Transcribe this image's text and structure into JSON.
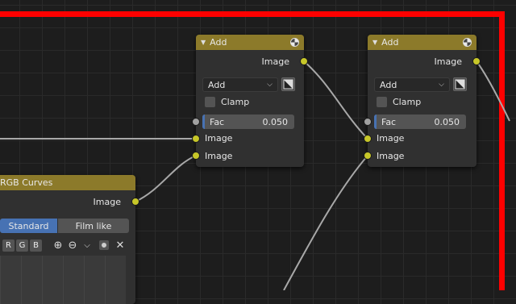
{
  "nodes": {
    "add_1": {
      "title": "Add",
      "output_label": "Image",
      "blend_mode": "Add",
      "clamp_label": "Clamp",
      "clamp_checked": false,
      "fac_label": "Fac",
      "fac_value": "0.050",
      "inputs": [
        "Image",
        "Image"
      ]
    },
    "add_2": {
      "title": "Add",
      "output_label": "Image",
      "blend_mode": "Add",
      "clamp_label": "Clamp",
      "clamp_checked": false,
      "fac_label": "Fac",
      "fac_value": "0.050",
      "inputs": [
        "Image",
        "Image"
      ]
    },
    "rgb_curves": {
      "title": "RGB Curves",
      "output_label": "Image",
      "tabs": [
        "Standard",
        "Film like"
      ],
      "active_tab": "Standard",
      "channels": [
        "R",
        "G",
        "B"
      ],
      "tools": [
        "zoom-in-icon",
        "zoom-out-icon",
        "chevron-down-icon",
        "dot-icon",
        "close-icon"
      ]
    }
  },
  "colors": {
    "frame_border": "#ff0000",
    "header_color_node": "#8c7a2a",
    "socket_color": "#c7c729",
    "socket_float": "#a1a1a1",
    "accent": "#4772b3"
  }
}
